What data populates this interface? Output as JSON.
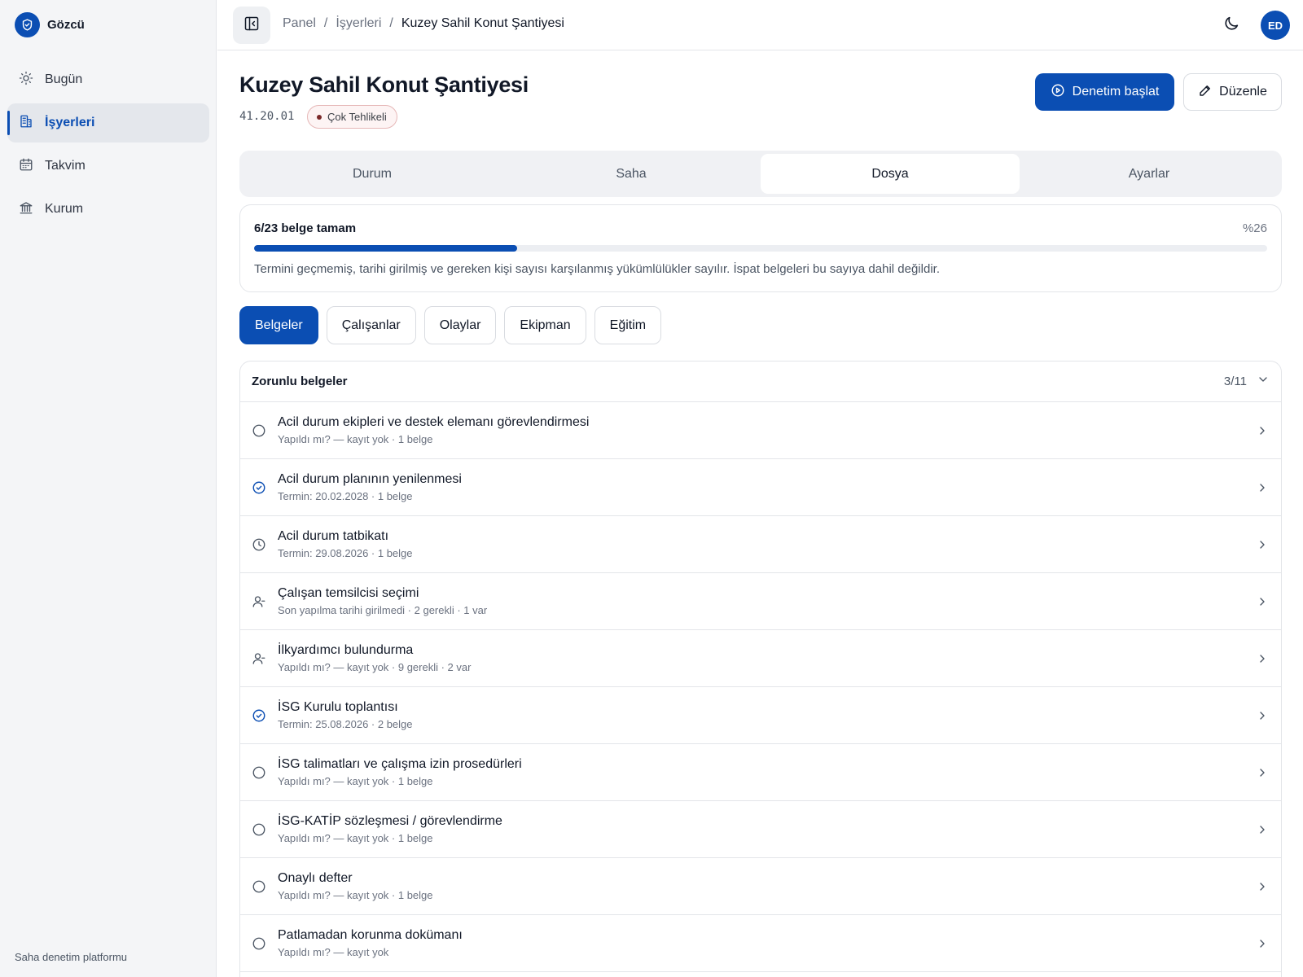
{
  "app": {
    "name": "Gözcü",
    "tagline": "Saha denetim platformu"
  },
  "sidebar": {
    "items": [
      {
        "label": "Bugün",
        "icon": "sun-icon"
      },
      {
        "label": "İşyerleri",
        "icon": "building-icon",
        "active": true
      },
      {
        "label": "Takvim",
        "icon": "calendar-icon"
      },
      {
        "label": "Kurum",
        "icon": "institution-icon"
      }
    ]
  },
  "topbar": {
    "breadcrumb": [
      "Panel",
      "İşyerleri",
      "Kuzey Sahil Konut Şantiyesi"
    ],
    "separator": "/",
    "avatar_initials": "ED"
  },
  "header": {
    "title": "Kuzey Sahil Konut Şantiyesi",
    "code": "41.20.01",
    "hazard_badge": "Çok Tehlikeli",
    "primary_action": "Denetim başlat",
    "secondary_action": "Düzenle"
  },
  "tabs": [
    {
      "label": "Durum"
    },
    {
      "label": "Saha"
    },
    {
      "label": "Dosya",
      "active": true
    },
    {
      "label": "Ayarlar"
    }
  ],
  "progress": {
    "label": "6/23 belge tamam",
    "percent_text": "%26",
    "fraction": 0.26,
    "note": "Termini geçmemiş, tarihi girilmiş ve gereken kişi sayısı karşılanmış yükümlülükler sayılır. İspat belgeleri bu sayıya dahil değildir."
  },
  "subtabs": [
    {
      "label": "Belgeler",
      "active": true
    },
    {
      "label": "Çalışanlar"
    },
    {
      "label": "Olaylar"
    },
    {
      "label": "Ekipman"
    },
    {
      "label": "Eğitim"
    }
  ],
  "documents": {
    "section_title": "Zorunlu belgeler",
    "count": "3/11",
    "rows": [
      {
        "title": "Acil durum ekipleri ve destek elemanı görevlendirmesi",
        "meta": "Yapıldı mı? — kayıt yok · 1 belge",
        "status": "empty"
      },
      {
        "title": "Acil durum planının yenilenmesi",
        "meta": "Termin: 20.02.2028 · 1 belge",
        "status": "done"
      },
      {
        "title": "Acil durum tatbikatı",
        "meta": "Termin: 29.08.2026 · 1 belge",
        "status": "clock"
      },
      {
        "title": "Çalışan temsilcisi seçimi",
        "meta": "Son yapılma tarihi girilmedi · 2 gerekli · 1 var",
        "status": "person"
      },
      {
        "title": "İlkyardımcı bulundurma",
        "meta": "Yapıldı mı? — kayıt yok · 9 gerekli · 2 var",
        "status": "person"
      },
      {
        "title": "İSG Kurulu toplantısı",
        "meta": "Termin: 25.08.2026 · 2 belge",
        "status": "done"
      },
      {
        "title": "İSG talimatları ve çalışma izin prosedürleri",
        "meta": "Yapıldı mı? — kayıt yok · 1 belge",
        "status": "empty"
      },
      {
        "title": "İSG-KATİP sözleşmesi / görevlendirme",
        "meta": "Yapıldı mı? — kayıt yok · 1 belge",
        "status": "empty"
      },
      {
        "title": "Onaylı defter",
        "meta": "Yapıldı mı? — kayıt yok · 1 belge",
        "status": "empty"
      },
      {
        "title": "Patlamadan korunma dokümanı",
        "meta": "Yapıldı mı? — kayıt yok",
        "status": "empty"
      }
    ]
  },
  "colors": {
    "accent": "#0b4eb3",
    "sidebar_bg": "#f4f5f7",
    "hazard_dot": "#7a2a2a"
  }
}
